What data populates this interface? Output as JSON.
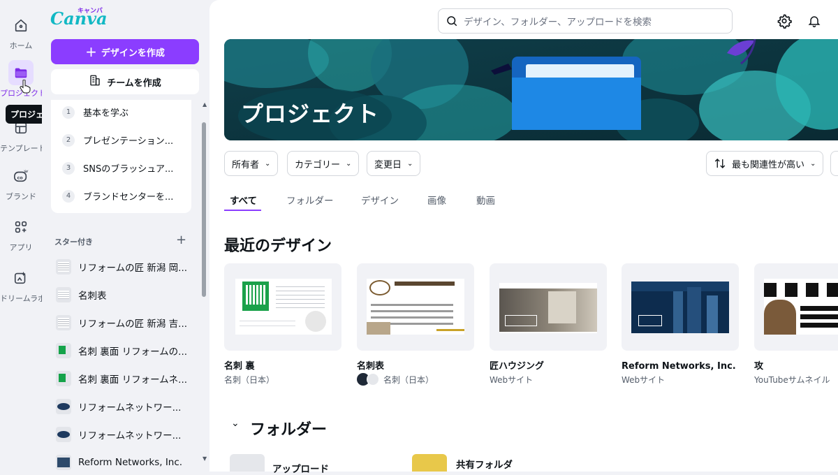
{
  "app": {
    "logo_text": "Canva",
    "logo_kana": "キャンバ"
  },
  "rail": {
    "items": [
      {
        "label": "ホーム",
        "icon": "home-icon"
      },
      {
        "label": "プロジェクト",
        "icon": "folder-icon"
      },
      {
        "label": "テンプレート",
        "icon": "template-icon"
      },
      {
        "label": "ブランド",
        "icon": "brand-icon"
      },
      {
        "label": "アプリ",
        "icon": "apps-icon"
      },
      {
        "label": "ドリームラボ",
        "icon": "dream-lab-icon"
      }
    ],
    "tooltip": "プロジェクト"
  },
  "panel": {
    "create_label": "デザインを作成",
    "team_label": "チームを作成",
    "learn_items": [
      {
        "num": "1",
        "label": "基本を学ぶ"
      },
      {
        "num": "2",
        "label": "プレゼンテーション..."
      },
      {
        "num": "3",
        "label": "SNSのブラッシュア..."
      },
      {
        "num": "4",
        "label": "ブランドセンターを..."
      }
    ],
    "starred_heading": "スター付き",
    "starred": [
      "リフォームの匠 新潟 岡...",
      "名刺表",
      "リフォームの匠 新潟 吉...",
      "名刺 裏面 リフォームの...",
      "名刺 裏面 リフォームネ...",
      "リフォームネットワー...",
      "リフォームネットワー...",
      "Reform Networks, Inc."
    ]
  },
  "search": {
    "placeholder": "デザイン、フォルダー、アップロードを検索"
  },
  "banner": {
    "title": "プロジェクト"
  },
  "filters": {
    "owner": "所有者",
    "category": "カテゴリー",
    "modified": "変更日",
    "sort": "最も関連性が高い"
  },
  "tabs": [
    "すべて",
    "フォルダー",
    "デザイン",
    "画像",
    "動画"
  ],
  "recent": {
    "heading": "最近のデザイン",
    "cards": [
      {
        "name": "名刺 裏",
        "sub": "名刺（日本）"
      },
      {
        "name": "名刺表",
        "sub": "名刺（日本）"
      },
      {
        "name": "匠ハウジング",
        "sub": "Webサイト"
      },
      {
        "name": "Reform Networks, Inc.（...",
        "sub": "Webサイト"
      },
      {
        "name": "攻",
        "sub": "YouTubeサムネイル"
      }
    ]
  },
  "folders": {
    "heading": "フォルダー",
    "items": [
      "アップロード",
      "共有フォルダ"
    ]
  },
  "colors": {
    "accent": "#8b3dff",
    "banner": "#0c3b43",
    "logo": "#12b8c4"
  }
}
